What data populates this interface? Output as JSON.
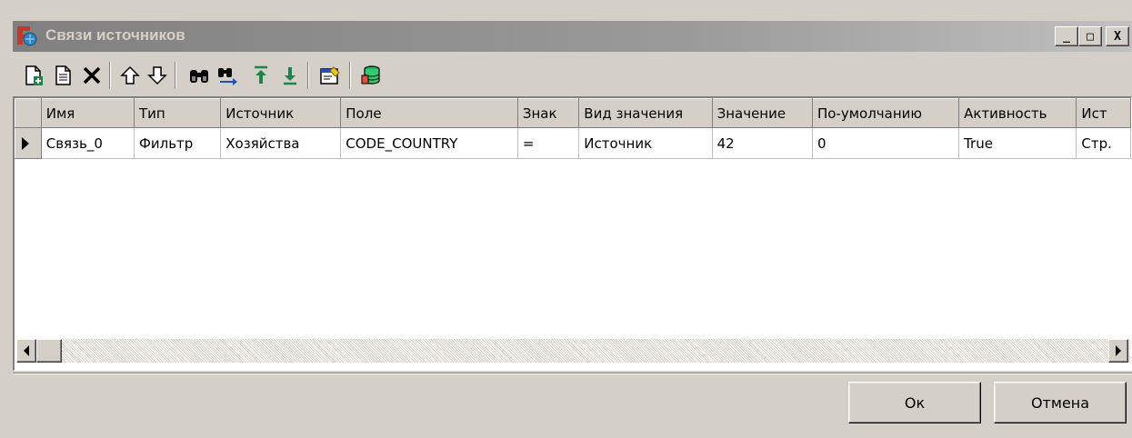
{
  "window": {
    "title": "Связи источников",
    "controls": {
      "minimize": "_",
      "maximize": "□",
      "close": "X"
    }
  },
  "toolbar": {
    "buttons": [
      {
        "icon": "new-record-icon"
      },
      {
        "icon": "copy-record-icon"
      },
      {
        "icon": "delete-icon"
      },
      {
        "icon": "arrow-up-icon"
      },
      {
        "icon": "arrow-down-icon"
      },
      {
        "icon": "find-icon"
      },
      {
        "icon": "find-next-icon"
      },
      {
        "icon": "move-top-icon"
      },
      {
        "icon": "move-bottom-icon"
      },
      {
        "icon": "properties-icon"
      },
      {
        "icon": "database-icon"
      }
    ]
  },
  "grid": {
    "columns": [
      "Имя",
      "Тип",
      "Источник",
      "Поле",
      "Знак",
      "Вид значения",
      "Значение",
      "По-умолчанию",
      "Активность",
      "Ист"
    ],
    "rows": [
      {
        "cells": [
          "Связь_0",
          "Фильтр",
          "Хозяйства",
          "CODE_COUNTRY",
          "=",
          "Источник",
          "42",
          "0",
          "True",
          "Стр."
        ]
      }
    ]
  },
  "buttons": {
    "ok": "Ок",
    "cancel": "Отмена"
  }
}
